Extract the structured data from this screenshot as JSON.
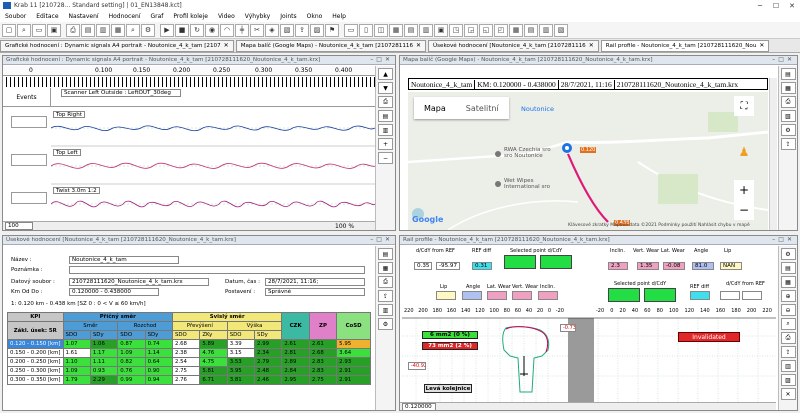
{
  "titlebar": {
    "title": "Krab 11 [210728... Standard setting] | 01_EN13848.kct]"
  },
  "menu": [
    "Soubor",
    "Editace",
    "Nastavení",
    "Hodnocení",
    "Graf",
    "Profil koleje",
    "Video",
    "Výhybky",
    "Joints",
    "Okno",
    "Help"
  ],
  "tabs": [
    {
      "label": "Grafické hodnocení : Dynamic signals A4 portrait - Noutonice_4_k_tam [2107",
      "active": false
    },
    {
      "label": "Mapa balíč (Google Maps) - Noutonice_4_k_tam [2107281116",
      "active": false
    },
    {
      "label": "Úsekové hodnocení [Noutonice_4_k_tam [2107281116",
      "active": false
    },
    {
      "label": "Rail profile - Noutonice_4_k_tam [210728111620_Nou",
      "active": true
    }
  ],
  "graphic": {
    "title": "Grafické hodnocení : Dynamic signals A4 portrait - Noutonice_4_k_tam [210728111620_Noutonice_4_k_tam.krx]",
    "km_ticks": [
      "0",
      "0.100",
      "0.150",
      "0.200",
      "0.250",
      "0.300",
      "0.350",
      "0.400"
    ],
    "events_label": "Events",
    "events_text": "Scanner Left Outside : LeftOUT_30deg",
    "top_right": "Top Right",
    "top_left": "Top Left",
    "twist": "Twist 3.0m  1:2",
    "zoom": "100",
    "pct": "100 %"
  },
  "map": {
    "title": "Mapa balíč (Google Maps) - Noutonice_4_k_tam [210728111620_Noutonice_4_k_tam.krx]",
    "info_name": "Noutonice_4_k_tam",
    "info_km": "KM: 0.120000 - 0.438000",
    "info_date": "28/7/2021, 11:16",
    "info_file": "210728111620_Noutonice_4_k_tam.krx",
    "btn_map": "Mapa",
    "btn_sat": "Satelitní",
    "place": "Noutonice",
    "poi1": "RWA Czechia sro",
    "poi1b": "sro Noutonice",
    "poi2": "Wet Wipes",
    "poi2b": "International sro",
    "m1": "0.120",
    "m2": "0.438",
    "google": "Google",
    "footer": "Klávesové zkratky  Mapová data ©2021  Podmínky použití  Nahlásit chybu v mapě"
  },
  "usek": {
    "title": "Úsekové hodnocení [Noutonice_4_k_tam [210728111620_Noutonice_4_k_tam.krx]",
    "name_lbl": "Název :",
    "name_val": "Noutonice_4_k_tam",
    "note_lbl": "Poznámka :",
    "file_lbl": "Datový soubor :",
    "file_val": "210728111620_Noutonice_4_k_tam.krx",
    "date_lbl": "Datum, čas :",
    "date_val": "28/7/2021, 11:16;",
    "km_lbl": "Km Od Do :",
    "km_val": "0.120000 - 0.438000",
    "pos_lbl": "Postavení :",
    "pos_val": "Správné",
    "range": "1: 0.120 km - 0.438 km [SZ 0 : 0 < V ≤ 60 km/h]",
    "hdr_kpi": "KPI",
    "hdr_pricny": "Příčný směr",
    "hdr_svisly": "Svislý směr",
    "hdr_zakl": "Zákl. úsek: 5R",
    "hdr_smer": "Směr",
    "hdr_rozchod": "Rozchod",
    "hdr_prevyseni": "Převýšení",
    "hdr_vyska": "Výška",
    "hdr_czk": "CZK",
    "hdr_zp": "ZP",
    "hdr_cosd": "CoSD",
    "sub": [
      "SDO",
      "SDy",
      "SDO",
      "SDy",
      "SDO",
      "ZKy",
      "SDO",
      "SDy"
    ],
    "rows": [
      {
        "km": "0.120 - 0.150 [km]",
        "v": [
          "1.07",
          "1.06",
          "0.87",
          "0.74",
          "2.68",
          "5.89",
          "3.39",
          "2.99",
          "2.61",
          "2.61",
          "5.95"
        ]
      },
      {
        "km": "0.150 - 0.200 [km]",
        "v": [
          "1.61",
          "1.17",
          "1.09",
          "1.14",
          "2.38",
          "4.76",
          "3.15",
          "2.34",
          "2.81",
          "2.68",
          "3.64"
        ]
      },
      {
        "km": "0.200 - 0.250 [km]",
        "v": [
          "1.10",
          "1.11",
          "0.82",
          "0.64",
          "2.54",
          "4.75",
          "3.53",
          "2.79",
          "2.89",
          "2.83",
          "2.93"
        ]
      },
      {
        "km": "0.250 - 0.300 [km]",
        "v": [
          "1.09",
          "0.93",
          "0.76",
          "0.90",
          "2.75",
          "5.81",
          "3.95",
          "2.48",
          "2.84",
          "2.83",
          "2.91"
        ]
      },
      {
        "km": "0.300 - 0.350 [km]",
        "v": [
          "1.79",
          "2.29",
          "0.99",
          "0.94",
          "2.76",
          "6.71",
          "3.81",
          "2.46",
          "2.95",
          "2.75",
          "2.91"
        ]
      }
    ]
  },
  "rail": {
    "title": "Rail profile - Noutonice_4_k_tam [210728111620_Noutonice_4_k_tam.krx]",
    "dcdy_ref": "d/CdY from REF",
    "ref_diff": "REF diff",
    "sel_point": "Selected point d/CdY",
    "v1": "0.35",
    "v2": "-95.97",
    "v3": "0.31",
    "inclin": "Inclin.",
    "vert_wear": "Vert. Wear",
    "lat_wear": "Lat. Wear",
    "angle": "Angle",
    "vi": "2.3",
    "vvw": "1.35",
    "vlw": "-0.08",
    "va": "81.0",
    "lip": "Lip",
    "vlip": "NAN",
    "l2": "Lip",
    "a2": "Angle",
    "lw2": "Lat. Wear",
    "vw2": "Vert. Wear",
    "in2": "Inclin.",
    "sp2": "Selected point d/CdY",
    "rd2": "REF diff",
    "dr2": "d/CdY from REF",
    "area1": "6 mm2 (0 %)",
    "area2": "73 mm2 (2 %)",
    "inv": "Invalidated",
    "leva": "Levá kolejnice",
    "r1": "-0.73",
    "r2": "-40.92",
    "status": "0.120000",
    "ticks": [
      "220",
      "200",
      "180",
      "160",
      "140",
      "120",
      "100",
      "80",
      "60",
      "40",
      "20",
      "0",
      "-20"
    ],
    "ticks2": [
      "-20",
      "0",
      "20",
      "40",
      "60",
      "80",
      "100",
      "120",
      "140",
      "160",
      "180",
      "200",
      "220"
    ]
  }
}
